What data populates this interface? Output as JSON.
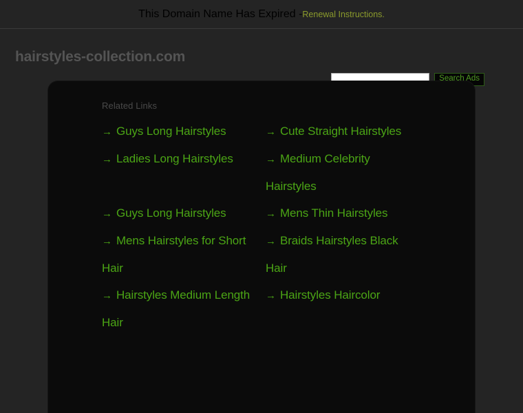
{
  "notice": {
    "message": "This Domain Name Has Expired - ",
    "link_label": "Renewal Instructions.",
    "link_color": "#8b9b2c"
  },
  "header": {
    "domain_title": "hairstyles-collection.com",
    "title_color": "#545454"
  },
  "search": {
    "value": "",
    "placeholder": "",
    "button_label": "Search Ads",
    "button_text_color": "#4f9a22"
  },
  "content": {
    "heading": "Related Links",
    "link_color": "#4ba515",
    "arrow_glyph": "→",
    "panel_background": "#0b0b0b",
    "page_background": "#242424",
    "links": [
      {
        "label": "Guys Long Hairstyles",
        "column": "left",
        "row": 1
      },
      {
        "label": "Cute Straight Hairstyles",
        "column": "right",
        "row": 1
      },
      {
        "label": "Ladies Long Hairstyles",
        "column": "left",
        "row": 2
      },
      {
        "label": "Medium Celebrity Hairstyles",
        "column": "right",
        "row": 2
      },
      {
        "label": "Guys Long Hairstyles",
        "column": "left",
        "row": 3
      },
      {
        "label": "Mens Thin Hairstyles",
        "column": "right",
        "row": 3
      },
      {
        "label": "Mens Hairstyles for Short Hair",
        "column": "left",
        "row": 4
      },
      {
        "label": "Braids Hairstyles Black Hair",
        "column": "right",
        "row": 4
      },
      {
        "label": "Hairstyles Medium Length Hair",
        "column": "left",
        "row": 5
      },
      {
        "label": "Hairstyles Haircolor",
        "column": "right",
        "row": 5
      }
    ]
  }
}
